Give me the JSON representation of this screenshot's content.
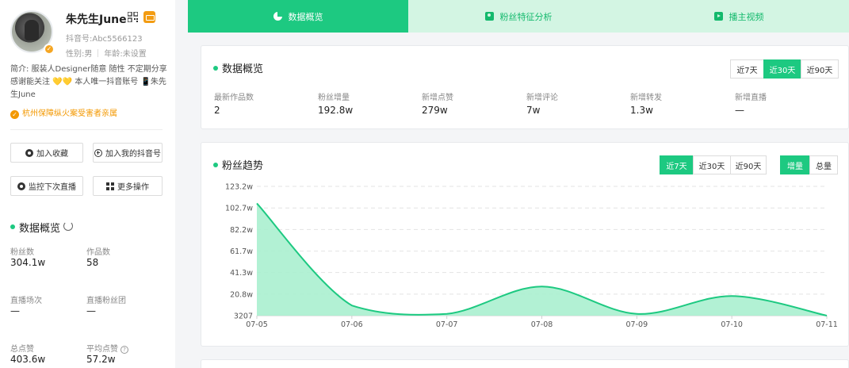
{
  "profile": {
    "name": "朱先生June",
    "douyin_id": "抖音号:Abc5566123",
    "gender": "性别:男",
    "age": "年龄:未设置",
    "bio_line1": "简介: 服装人Designer随意 随性 不定期分享",
    "bio_line2_a": "感谢能关注",
    "bio_line2_hearts": "💛💛",
    "bio_line2_b": "本人唯一抖音账号",
    "bio_line2_phone": "📱",
    "bio_line2_c": "朱先",
    "bio_line3": "生June",
    "location": "杭州保障纵火案受害者亲属"
  },
  "left_buttons": {
    "favorite": "加入收藏",
    "add_my": "加入我的抖音号",
    "monitor_live": "监控下次直播",
    "more": "更多操作"
  },
  "left_overview": {
    "title": "数据概览",
    "stats": [
      {
        "label": "粉丝数",
        "value": "304.1w"
      },
      {
        "label": "作品数",
        "value": "58"
      },
      {
        "label": "直播场次",
        "value": "—"
      },
      {
        "label": "直播粉丝团",
        "value": "—"
      },
      {
        "label": "总点赞",
        "value": "403.6w"
      },
      {
        "label": "平均点赞",
        "value": "57.2w"
      }
    ]
  },
  "tabs": [
    {
      "label": "数据概览",
      "icon": "pie-chart-icon"
    },
    {
      "label": "粉丝特征分析",
      "icon": "fans-icon"
    },
    {
      "label": "播主视频",
      "icon": "video-icon"
    }
  ],
  "overview_card": {
    "title": "数据概览",
    "ranges": [
      "近7天",
      "近30天",
      "近90天"
    ],
    "active_range": "近30天",
    "metrics": [
      {
        "label": "最新作品数",
        "value": "2"
      },
      {
        "label": "粉丝增量",
        "value": "192.8w"
      },
      {
        "label": "新增点赞",
        "value": "279w"
      },
      {
        "label": "新增评论",
        "value": "7w"
      },
      {
        "label": "新增转发",
        "value": "1.3w"
      },
      {
        "label": "新增直播",
        "value": "—"
      }
    ]
  },
  "trend_card": {
    "title": "粉丝趋势",
    "ranges": [
      "近7天",
      "近30天",
      "近90天"
    ],
    "active_range": "近7天",
    "modes": [
      "增量",
      "总量"
    ],
    "active_mode": "增量"
  },
  "colors": {
    "accent": "#1dc981",
    "tab_bg": "#d3f5e3",
    "area_fill": "#aaf0cf",
    "location": "#f39800"
  },
  "chart_data": {
    "type": "area",
    "x": [
      "07-05",
      "07-06",
      "07-07",
      "07-08",
      "07-09",
      "07-10",
      "07-11"
    ],
    "y_ticks": [
      "3207",
      "20.8w",
      "41.3w",
      "61.7w",
      "82.2w",
      "102.7w",
      "123.2w"
    ],
    "y_tick_values": [
      0.3207,
      20.8,
      41.3,
      61.7,
      82.2,
      102.7,
      123.2
    ],
    "series": [
      {
        "values": [
          107,
          10,
          2,
          28,
          2,
          19,
          0.3
        ]
      }
    ],
    "ylim": [
      0.3207,
      123.2
    ],
    "grid": true
  }
}
